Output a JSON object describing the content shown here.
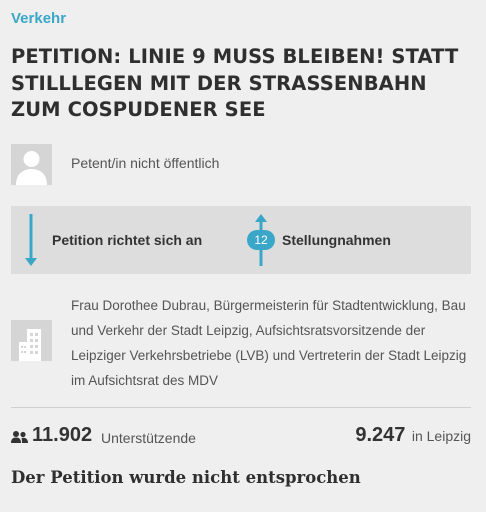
{
  "category": "Verkehr",
  "petition": {
    "title": "PETITION: LINIE 9 MUSS BLEIBEN! STATT STILLLEGEN MIT DER STRASSENBAHN ZUM COSPUDENER SEE"
  },
  "petent": {
    "text": "Petent/in nicht öffentlich",
    "icon": "avatar-placeholder-icon"
  },
  "info_box": {
    "addressed_label": "Petition richtet sich an",
    "statements_count": "12",
    "statements_label": "Stellungnahmen",
    "icons": [
      "arrow-down-icon",
      "arrow-up-icon"
    ]
  },
  "recipient": {
    "text": "Frau Dorothee Dubrau, Bürgermeisterin für Stadtentwicklung, Bau und Verkehr der Stadt Leipzig, Aufsichtsratsvorsitzende der Leipziger Verkehrsbetriebe (LVB) und Vertreterin der Stadt Leipzig im Aufsichtsrat des MDV",
    "icon": "building-icon"
  },
  "stats": {
    "supporters_count": "11.902",
    "supporters_label": "Unterstützende",
    "local_count": "9.247",
    "local_label": "in Leipzig"
  },
  "status": "Der Petition wurde nicht entsprochen",
  "colors": {
    "accent": "#3aa6c8",
    "background": "#efefef",
    "info_box": "#dddddd",
    "text": "#333333",
    "muted_text": "#555555"
  }
}
